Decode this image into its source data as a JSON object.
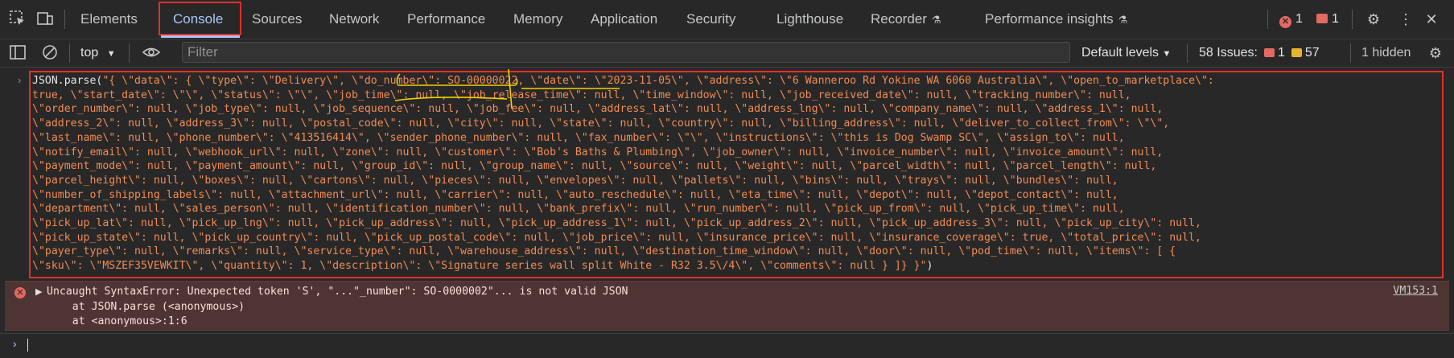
{
  "tabs": [
    "Elements",
    "Console",
    "Sources",
    "Network",
    "Performance",
    "Memory",
    "Application",
    "Security",
    "Lighthouse",
    "Recorder",
    "Performance insights"
  ],
  "active_tab": "Console",
  "status": {
    "errors": "1",
    "issues": "1"
  },
  "toolbar": {
    "context": "top",
    "filter_placeholder": "Filter",
    "levels": "Default levels",
    "issues_label": "58 Issues:",
    "issues_red": "1",
    "issues_yellow": "57",
    "hidden": "1 hidden"
  },
  "command": {
    "prefix": "JSON.parse(",
    "lines": [
      "\"{ \\\"data\\\": { \\\"type\\\": \\\"Delivery\\\", \\\"do_number\\\": SO-00000022, \\\"date\\\": \\\"2023-11-05\\\", \\\"address\\\": \\\"6 Wanneroo Rd Yokine WA 6060 Australia\\\", \\\"open_to_marketplace\\\":",
      "true, \\\"start_date\\\": \\\"\\\", \\\"status\\\": \\\"\\\", \\\"job_time\\\": null, \\\"job_release_time\\\": null, \\\"time_window\\\": null, \\\"job_received_date\\\": null, \\\"tracking_number\\\": null,",
      "\\\"order_number\\\": null, \\\"job_type\\\": null, \\\"job_sequence\\\": null, \\\"job_fee\\\": null, \\\"address_lat\\\": null, \\\"address_lng\\\": null, \\\"company_name\\\": null, \\\"address_1\\\": null,",
      "\\\"address_2\\\": null, \\\"address_3\\\": null, \\\"postal_code\\\": null, \\\"city\\\": null, \\\"state\\\": null, \\\"country\\\": null, \\\"billing_address\\\": null, \\\"deliver_to_collect_from\\\": \\\"\\\",",
      "\\\"last_name\\\": null, \\\"phone_number\\\": \\\"413516414\\\", \\\"sender_phone_number\\\": null, \\\"fax_number\\\": \\\"\\\", \\\"instructions\\\": \\\"this is Dog Swamp SC\\\", \\\"assign_to\\\": null,",
      "\\\"notify_email\\\": null, \\\"webhook_url\\\": null, \\\"zone\\\": null, \\\"customer\\\": \\\"Bob's Baths & Plumbing\\\", \\\"job_owner\\\": null, \\\"invoice_number\\\": null, \\\"invoice_amount\\\": null,",
      "\\\"payment_mode\\\": null, \\\"payment_amount\\\": null, \\\"group_id\\\": null, \\\"group_name\\\": null, \\\"source\\\": null, \\\"weight\\\": null, \\\"parcel_width\\\": null, \\\"parcel_length\\\": null,",
      "\\\"parcel_height\\\": null, \\\"boxes\\\": null, \\\"cartons\\\": null, \\\"pieces\\\": null, \\\"envelopes\\\": null, \\\"pallets\\\": null, \\\"bins\\\": null, \\\"trays\\\": null, \\\"bundles\\\": null,",
      "\\\"number_of_shipping_labels\\\": null, \\\"attachment_url\\\": null, \\\"carrier\\\": null, \\\"auto_reschedule\\\": null, \\\"eta_time\\\": null, \\\"depot\\\": null, \\\"depot_contact\\\": null,",
      "\\\"department\\\": null, \\\"sales_person\\\": null, \\\"identification_number\\\": null, \\\"bank_prefix\\\": null, \\\"run_number\\\": null, \\\"pick_up_from\\\": null, \\\"pick_up_time\\\": null,",
      "\\\"pick_up_lat\\\": null, \\\"pick_up_lng\\\": null, \\\"pick_up_address\\\": null, \\\"pick_up_address_1\\\": null, \\\"pick_up_address_2\\\": null, \\\"pick_up_address_3\\\": null, \\\"pick_up_city\\\": null,",
      "\\\"pick_up_state\\\": null, \\\"pick_up_country\\\": null, \\\"pick_up_postal_code\\\": null, \\\"job_price\\\": null, \\\"insurance_price\\\": null, \\\"insurance_coverage\\\": true, \\\"total_price\\\": null,",
      "\\\"payer_type\\\": null, \\\"remarks\\\": null, \\\"service_type\\\": null, \\\"warehouse_address\\\": null, \\\"destination_time_window\\\": null, \\\"door\\\": null, \\\"pod_time\\\": null, \\\"items\\\": [ {",
      "\\\"sku\\\": \\\"MSZEF35VEWKIT\\\", \\\"quantity\\\": 1, \\\"description\\\": \\\"Signature series wall split White - R32 3.5\\/4\\\", \\\"comments\\\": null } ]} }\""
    ],
    "suffix": ")"
  },
  "error": {
    "message": "Uncaught SyntaxError: Unexpected token 'S', \"...\"_number\": SO-0000002\"... is not valid JSON",
    "trace1": "    at JSON.parse (<anonymous>)",
    "trace2": "    at <anonymous>:1:6",
    "source": "VM153:1"
  },
  "colors": {
    "accent": "#a8c7fa",
    "error": "#e46962",
    "highlight": "#e0302a",
    "annotation": "#f5d000"
  }
}
